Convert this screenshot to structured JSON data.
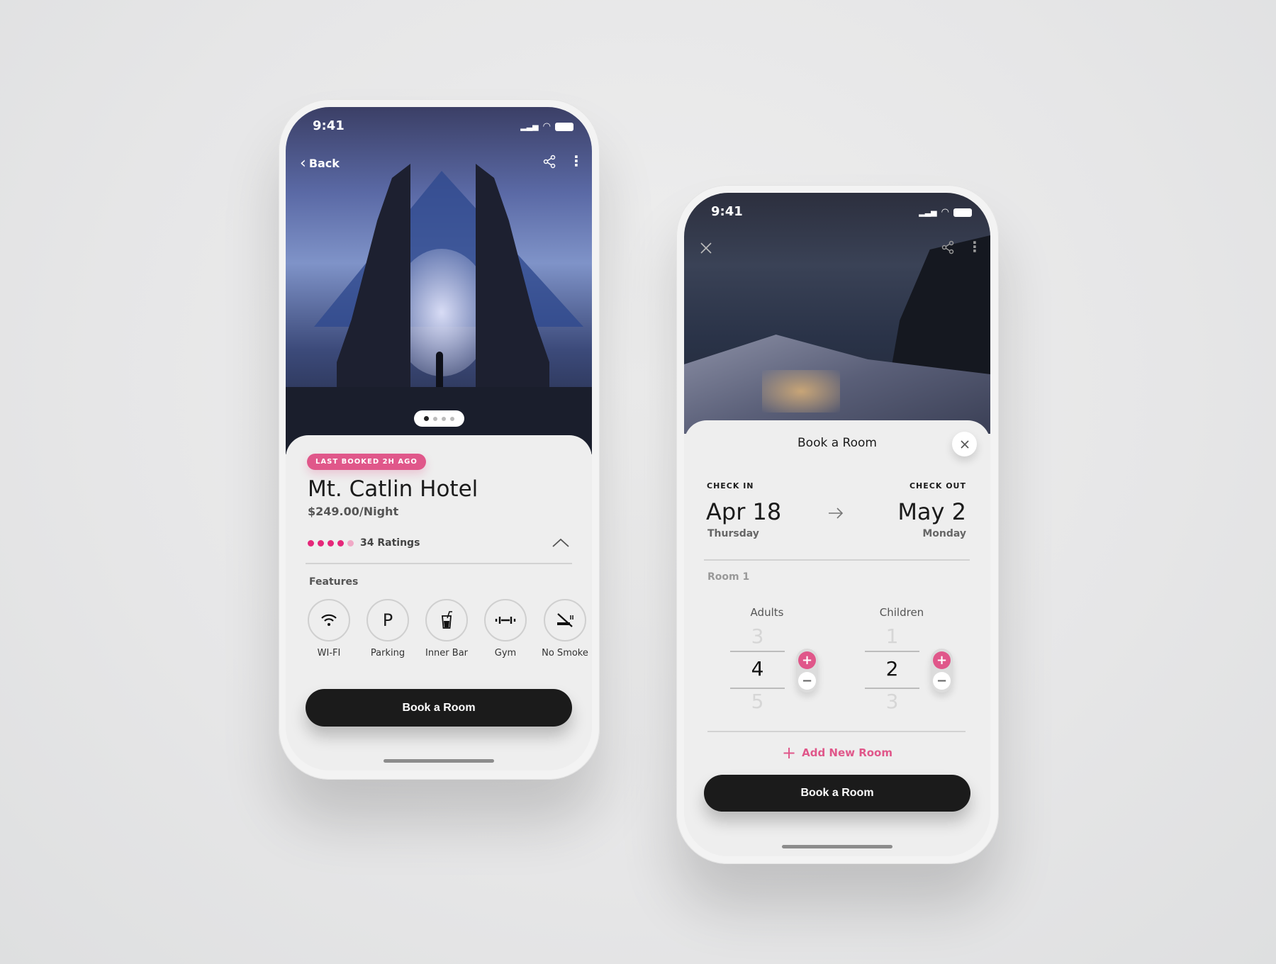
{
  "hotel_screen": {
    "status_time": "9:41",
    "back_label": "Back",
    "badge": "LAST BOOKED 2H AGO",
    "title": "Mt. Catlin Hotel",
    "price": "$249.00/Night",
    "rating": {
      "value": 4,
      "max": 5,
      "label": "34 Ratings"
    },
    "carousel": {
      "current": 1,
      "total": 4
    },
    "features_label": "Features",
    "features": [
      {
        "label": "WI-FI",
        "icon": "wifi-icon"
      },
      {
        "label": "Parking",
        "icon": "parking-icon"
      },
      {
        "label": "Inner Bar",
        "icon": "drink-icon"
      },
      {
        "label": "Gym",
        "icon": "dumbbell-icon"
      },
      {
        "label": "No Smoke",
        "icon": "no-smoking-icon"
      }
    ],
    "book_button": "Book a Room"
  },
  "booking_screen": {
    "status_time": "9:41",
    "sheet_title": "Book a Room",
    "check_in": {
      "label": "CHECK IN",
      "date": "Apr 18",
      "day": "Thursday"
    },
    "check_out": {
      "label": "CHECK OUT",
      "date": "May 2",
      "day": "Monday"
    },
    "room_label": "Room 1",
    "adults": {
      "label": "Adults",
      "prev": "3",
      "value": "4",
      "next": "5"
    },
    "children": {
      "label": "Children",
      "prev": "1",
      "value": "2",
      "next": "3"
    },
    "add_room": "Add New Room",
    "book_button": "Book a Room"
  },
  "colors": {
    "accent": "#e0578a",
    "button": "#1b1b1b",
    "background": "#e8e8e8"
  }
}
